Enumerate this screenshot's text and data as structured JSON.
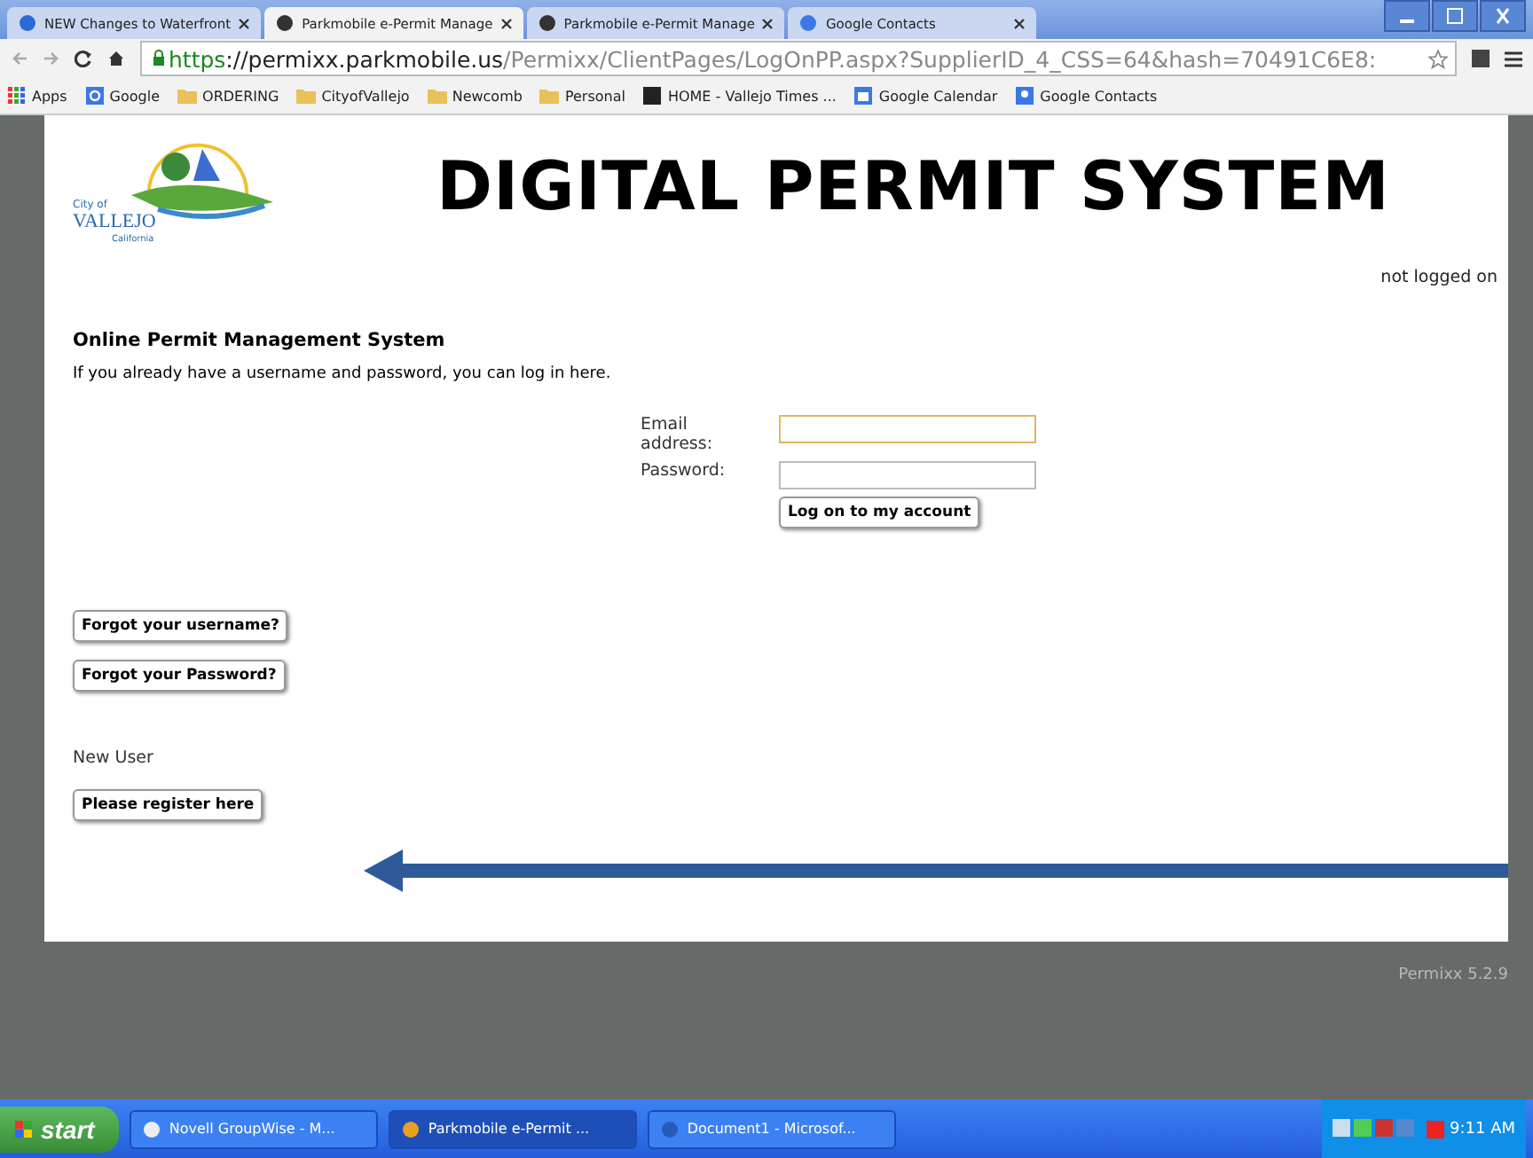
{
  "browser": {
    "tabs": [
      {
        "title": "NEW Changes to Waterfront",
        "selected": false
      },
      {
        "title": "Parkmobile e-Permit Manage",
        "selected": true
      },
      {
        "title": "Parkmobile e-Permit Manage",
        "selected": false
      },
      {
        "title": "Google Contacts",
        "selected": false
      }
    ],
    "address": {
      "scheme": "https",
      "host": "://permixx.parkmobile.us",
      "path": "/Permixx/ClientPages/LogOnPP.aspx?SupplierID_4_CSS=64&hash=70491C6E8:"
    },
    "bookmarks": [
      {
        "label": "Apps",
        "kind": "apps"
      },
      {
        "label": "Google",
        "kind": "google"
      },
      {
        "label": "ORDERING",
        "kind": "folder"
      },
      {
        "label": "CityofVallejo",
        "kind": "folder"
      },
      {
        "label": "Newcomb",
        "kind": "folder"
      },
      {
        "label": "Personal",
        "kind": "folder"
      },
      {
        "label": "HOME - Vallejo Times ...",
        "kind": "th"
      },
      {
        "label": "Google Calendar",
        "kind": "calendar"
      },
      {
        "label": "Google Contacts",
        "kind": "contacts"
      }
    ]
  },
  "page": {
    "logo": {
      "line1": "City of",
      "line2": "VALLEJO",
      "line3": "California"
    },
    "heading": "DIGITAL PERMIT SYSTEM",
    "login_status": "not logged on",
    "section_title": "Online Permit Management System",
    "intro": "If you already have a username and password, you can log in here.",
    "form": {
      "email_label": "Email address:",
      "email_focused": true,
      "password_label": "Password:",
      "submit": "Log on to my account"
    },
    "forgot_buttons": [
      "Forgot your username?",
      "Forgot your Password?"
    ],
    "new_user_label": "New User",
    "register_button": "Please register here",
    "version": "Permixx 5.2.9"
  },
  "taskbar": {
    "start": "start",
    "items": [
      {
        "label": "Novell GroupWise - M...",
        "selected": false
      },
      {
        "label": "Parkmobile e-Permit ...",
        "selected": true
      },
      {
        "label": "Document1 - Microsof...",
        "selected": false
      }
    ],
    "clock": "9:11 AM"
  }
}
